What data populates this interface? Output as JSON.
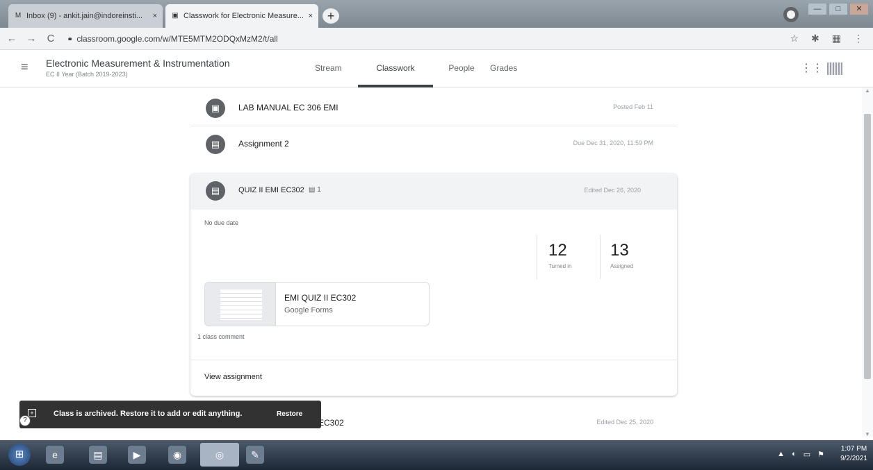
{
  "browser": {
    "tabs": [
      {
        "favicon": "gmail-icon",
        "label": "Inbox (9) - ankit.jain@indoreinsti...",
        "close": "×"
      },
      {
        "favicon": "classroom-icon",
        "label": "Classwork for Electronic Measure...",
        "close": "×"
      }
    ],
    "new_tab": "+",
    "window_controls": {
      "minimize": "—",
      "maximize": "□",
      "close": "✕"
    },
    "nav": {
      "back": "←",
      "forward": "→",
      "reload": "C"
    },
    "url": "classroom.google.com/w/MTE5MTM2ODQxMzM2/t/all",
    "right_icons": {
      "star": "☆",
      "extensions": "✱",
      "profile": "▦",
      "menu": "⋮"
    }
  },
  "classroom": {
    "menu_icon": "≡",
    "class_title": "Electronic Measurement & Instrumentation",
    "class_subtitle": "EC II Year (Batch 2019-2023)",
    "tabs": [
      "Stream",
      "Classwork",
      "People",
      "Grades"
    ],
    "active_tab": "Classwork",
    "apps_icon": "⋮⋮⋮"
  },
  "classwork": {
    "rows": [
      {
        "icon": "▣",
        "title": "LAB MANUAL EC 306 EMI",
        "meta": "Posted Feb 11"
      },
      {
        "icon": "▤",
        "title": "Assignment 2",
        "meta": "Due Dec 31, 2020, 11:59 PM"
      }
    ],
    "expanded": {
      "icon": "▤",
      "title": "QUIZ II EMI EC302",
      "comment_badge": "▤ 1",
      "meta": "Edited Dec 26, 2020",
      "due": "No due date",
      "turned_in": {
        "value": "12",
        "label": "Turned in"
      },
      "assigned": {
        "value": "13",
        "label": "Assigned"
      },
      "attachment": {
        "name": "EMI QUIZ II EC302",
        "type": "Google Forms"
      },
      "class_comments": "1 class comment",
      "view": "View assignment"
    },
    "partial_row": {
      "title": "EC302",
      "meta": "Edited Dec 25, 2020"
    }
  },
  "snackbar": {
    "icon": "+",
    "message": "Class is archived. Restore it to add or edit anything.",
    "action": "Restore"
  },
  "help_icon": "?",
  "taskbar": {
    "start": "⊞",
    "apps": [
      {
        "name": "ie-icon",
        "glyph": "e"
      },
      {
        "name": "explorer-icon",
        "glyph": "▤"
      },
      {
        "name": "media-icon",
        "glyph": "▶"
      },
      {
        "name": "media-player-icon",
        "glyph": "◉"
      },
      {
        "name": "chrome-icon",
        "glyph": "◎"
      },
      {
        "name": "notepad-icon",
        "glyph": "✎"
      }
    ],
    "tray": [
      "▲",
      "◐",
      "▭",
      "⚑"
    ],
    "time": "1:07 PM",
    "date": "9/2/2021"
  }
}
